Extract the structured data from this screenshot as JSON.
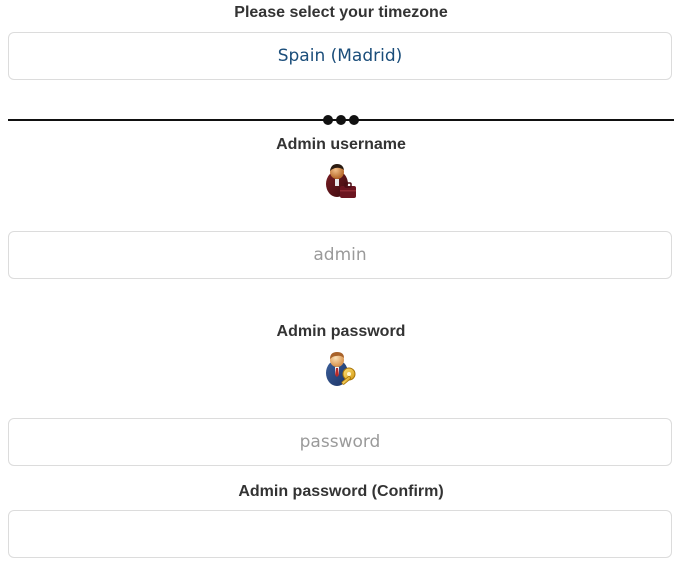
{
  "timezone": {
    "label": "Please select your timezone",
    "selected_value": "Spain (Madrid)"
  },
  "admin_username": {
    "label": "Admin username",
    "icon": "user-briefcase-icon",
    "placeholder": "admin"
  },
  "admin_password": {
    "label": "Admin password",
    "icon": "user-key-icon",
    "placeholder": "password"
  },
  "admin_password_confirm": {
    "label": "Admin password (Confirm)",
    "placeholder": ""
  },
  "colors": {
    "label_text": "#333333",
    "select_text": "#1a4d7a",
    "placeholder": "#9a9a9a",
    "border": "#dcdcdc",
    "divider": "#111111"
  }
}
